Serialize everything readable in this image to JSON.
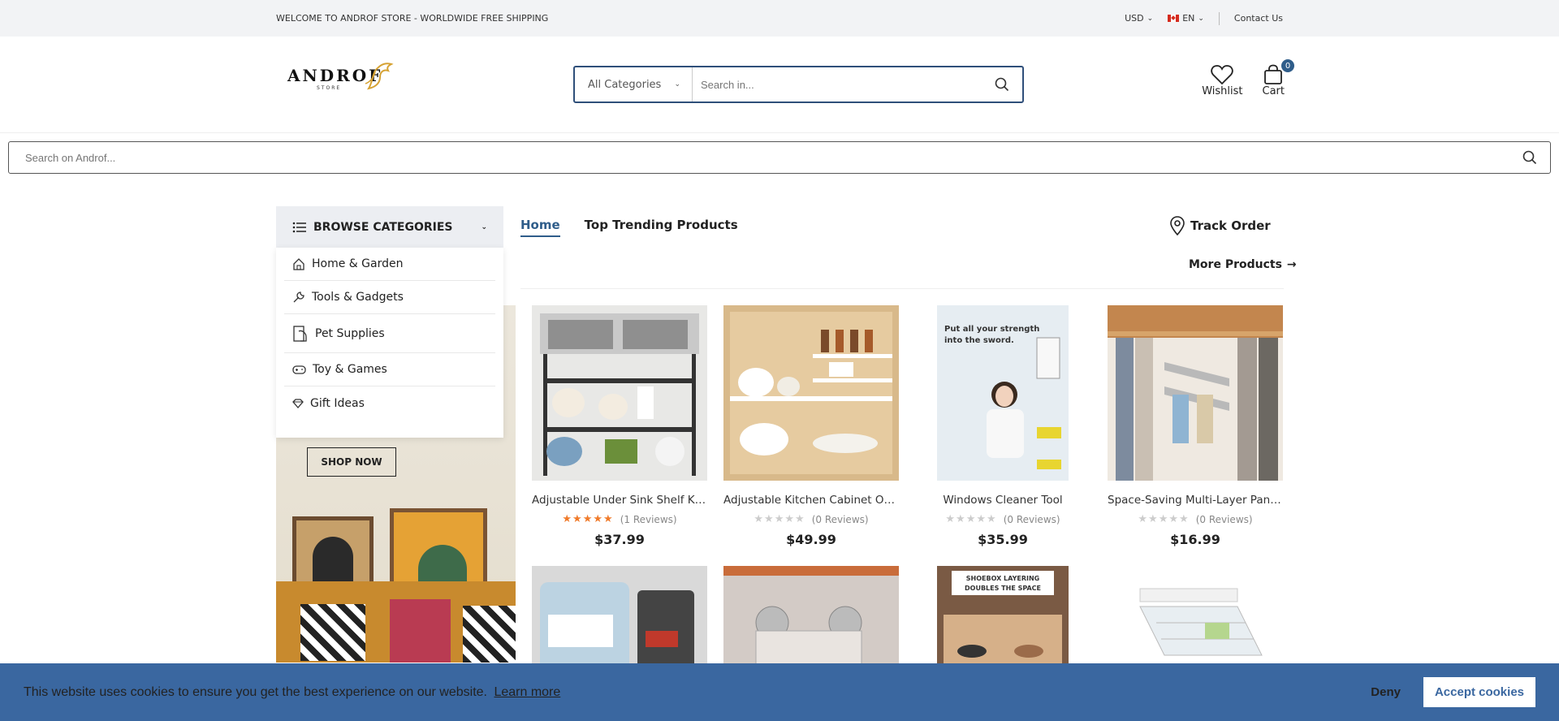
{
  "topbar": {
    "welcome": "WELCOME TO ANDROF STORE - WORLDWIDE FREE SHIPPING",
    "currency": "USD",
    "language": "EN",
    "contact": "Contact Us"
  },
  "header": {
    "logo_text": "ANDROF",
    "logo_sub": "STORE",
    "category_select": "All Categories",
    "search_placeholder": "Search in...",
    "wishlist_label": "Wishlist",
    "cart_label": "Cart",
    "cart_count": "0"
  },
  "wide_search": {
    "placeholder": "Search on Androf..."
  },
  "nav": {
    "browse_label": "BROWSE CATEGORIES",
    "links": [
      "Home",
      "Top Trending Products"
    ],
    "track_order": "Track Order",
    "more_products": "More Products"
  },
  "categories": [
    "Home & Garden",
    "Tools & Gadgets",
    "Pet Supplies",
    "Toy & Games",
    "Gift Ideas"
  ],
  "banner": {
    "button": "SHOP NOW"
  },
  "products": [
    {
      "name": "Adjustable Under Sink Shelf Kitc...",
      "reviews": "(1 Reviews)",
      "rating": 5,
      "price": "$37.99"
    },
    {
      "name": "Adjustable Kitchen Cabinet Org...",
      "reviews": "(0 Reviews)",
      "rating": 0,
      "price": "$49.99"
    },
    {
      "name": "Windows Cleaner Tool",
      "reviews": "(0 Reviews)",
      "rating": 0,
      "price": "$35.99"
    },
    {
      "name": "Space-Saving Multi-Layer Pant...",
      "reviews": "(0 Reviews)",
      "rating": 0,
      "price": "$16.99"
    }
  ],
  "product_images": {
    "windows_text": "Put all your strength into the sword.",
    "shoebox_text": "SHOEBOX LAYERING DOUBLES THE SPACE"
  },
  "cookie": {
    "message": "This website uses cookies to ensure you get the best experience on our website.",
    "learn_more": "Learn more",
    "deny": "Deny",
    "accept": "Accept cookies"
  },
  "colors": {
    "accent": "#2f5d8a",
    "cookie_bg": "#3a67a0",
    "star": "#f07a2a"
  }
}
